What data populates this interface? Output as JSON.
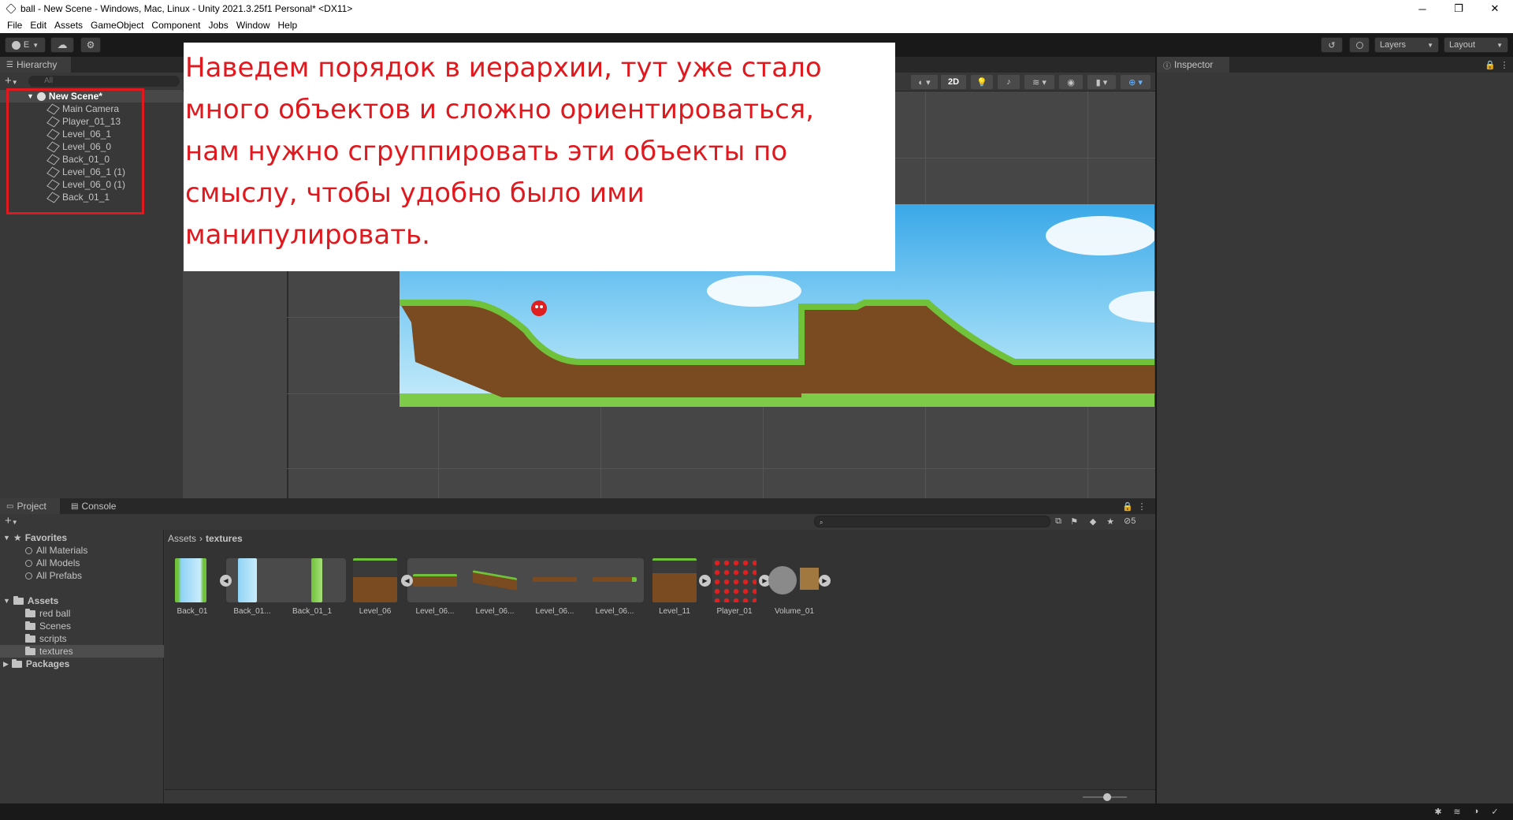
{
  "window": {
    "title": "ball - New Scene - Windows, Mac, Linux - Unity 2021.3.25f1 Personal* <DX11>",
    "minimize": "─",
    "restore": "❐",
    "close": "✕"
  },
  "menu": [
    "File",
    "Edit",
    "Assets",
    "GameObject",
    "Component",
    "Jobs",
    "Window",
    "Help"
  ],
  "toolbar": {
    "account_label": "E",
    "layers_label": "Layers",
    "layout_label": "Layout",
    "mode_2d": "2D"
  },
  "hierarchy": {
    "tab": "Hierarchy",
    "search_placeholder": "All",
    "scene": "New Scene*",
    "items": [
      "Main Camera",
      "Player_01_13",
      "Level_06_1",
      "Level_06_0",
      "Back_01_0",
      "Level_06_1 (1)",
      "Level_06_0 (1)",
      "Back_01_1"
    ]
  },
  "inspector": {
    "tab": "Inspector"
  },
  "project": {
    "tabs": [
      "Project",
      "Console"
    ],
    "badge_count": "5",
    "breadcrumb": [
      "Assets",
      "textures"
    ],
    "favorites": {
      "label": "Favorites",
      "items": [
        "All Materials",
        "All Models",
        "All Prefabs"
      ]
    },
    "assets": {
      "label": "Assets",
      "items": [
        "red ball",
        "Scenes",
        "scripts",
        "textures"
      ]
    },
    "packages": "Packages",
    "grid": [
      "Back_01",
      "Back_01...",
      "Back_01_1",
      "Level_06",
      "Level_06...",
      "Level_06...",
      "Level_06...",
      "Level_06...",
      "Level_11",
      "Player_01",
      "Volume_01"
    ]
  },
  "annotation": {
    "text": "Наведем порядок в иерархии, тут уже стало\nмного объектов и сложно ориентироваться,\nнам нужно сгруппировать эти объекты по\nсмыслу, чтобы удобно было ими\nманипулировать."
  },
  "colors": {
    "annotation_red": "#e0191f",
    "editor_bg": "#383838"
  }
}
